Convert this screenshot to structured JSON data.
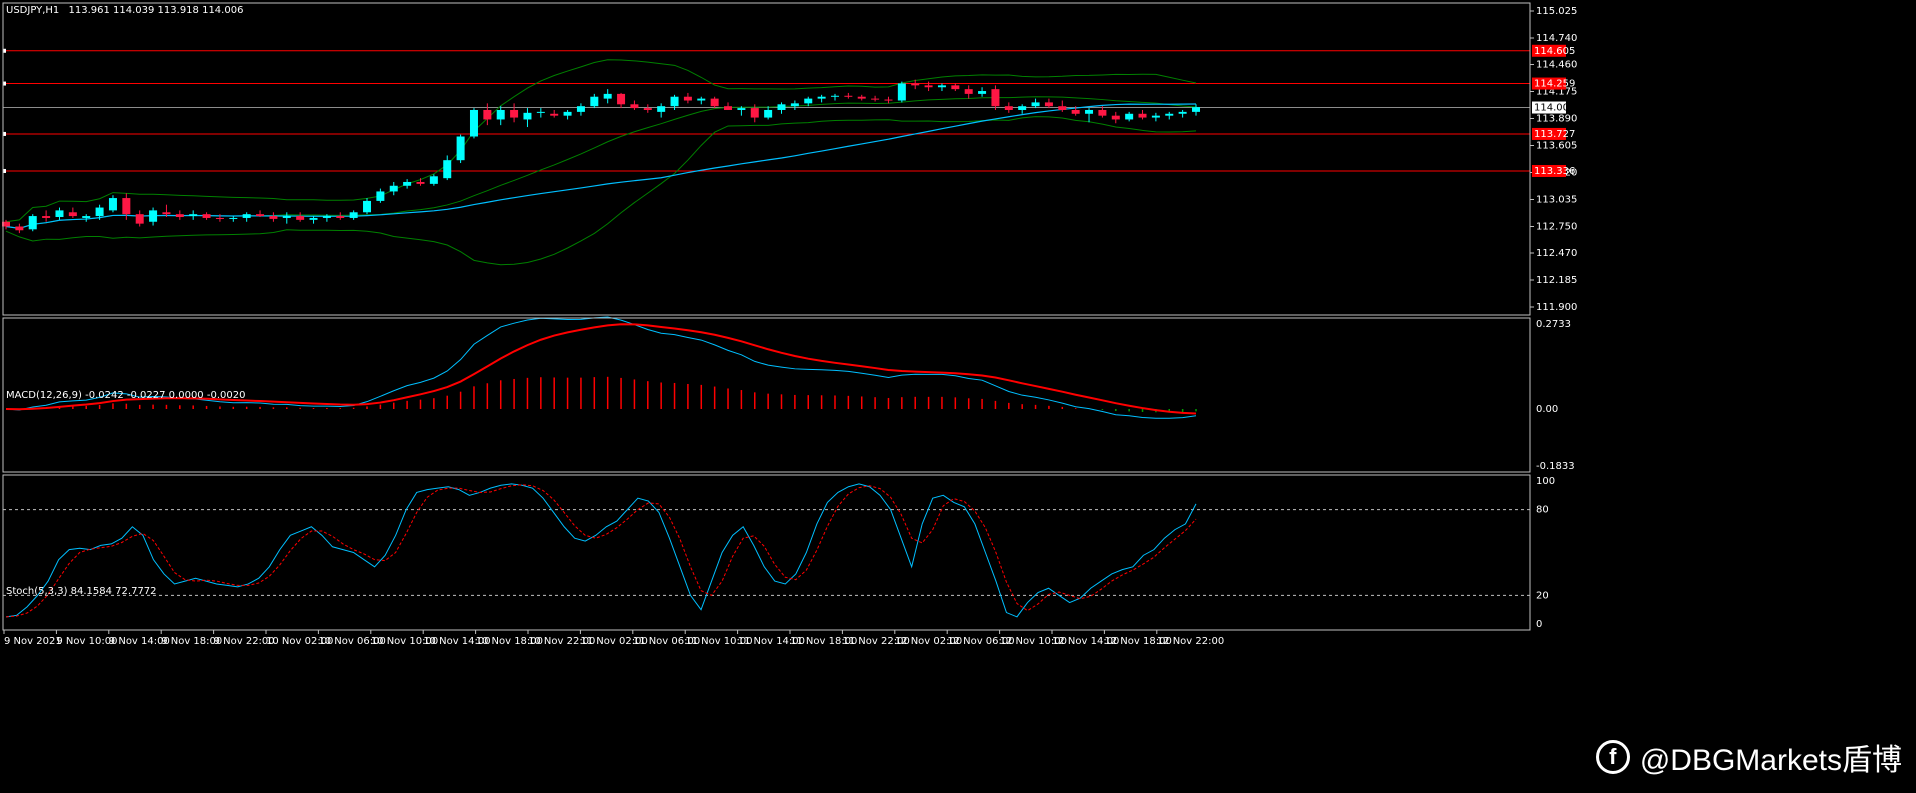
{
  "watermark": {
    "text": "@DBGMarkets盾博",
    "logo_icon": "f-logo-icon"
  },
  "colors": {
    "bg": "#000000",
    "frame": "#c0c0c0",
    "bull": "#00ffff",
    "bear": "#ff1744",
    "ma": "#00bfff",
    "bands": "#008000",
    "hline": "#ff0000",
    "macd_main": "#ffffff",
    "macd_signal": "#ff0000",
    "hist_pos": "#ff0000",
    "hist_neg": "#00a000",
    "stoch_main": "#00bfff",
    "stoch_signal": "#ff0000",
    "price_box": "#ffffff"
  },
  "chart_data": [
    {
      "type": "candlestick",
      "title": "USDJPY,H1",
      "ohlc_text": "113.961 114.039 113.918 114.006",
      "ylim": [
        111.9,
        115.025
      ],
      "price_ticks": [
        "115.025",
        "114.740",
        "114.460",
        "114.175",
        "113.890",
        "113.605",
        "113.320",
        "113.035",
        "112.750",
        "112.470",
        "112.185",
        "111.900"
      ],
      "current_price": "114.006",
      "horizontal_levels": [
        {
          "value": 114.605,
          "label": "114.605"
        },
        {
          "value": 114.259,
          "label": "114.259"
        },
        {
          "value": 113.727,
          "label": "113.727"
        },
        {
          "value": 113.336,
          "label": "113.336"
        }
      ],
      "x_labels": [
        "9 Nov 2021",
        "9 Nov 10:00",
        "9 Nov 14:00",
        "9 Nov 18:00",
        "9 Nov 22:00",
        "10 Nov 02:00",
        "10 Nov 06:00",
        "10 Nov 10:00",
        "10 Nov 14:00",
        "10 Nov 18:00",
        "10 Nov 22:00",
        "11 Nov 02:00",
        "11 Nov 06:00",
        "11 Nov 10:00",
        "11 Nov 14:00",
        "11 Nov 18:00",
        "11 Nov 22:00",
        "12 Nov 02:00",
        "12 Nov 06:00",
        "12 Nov 10:00",
        "12 Nov 14:00",
        "12 Nov 18:00",
        "12 Nov 22:00"
      ],
      "candles": [
        [
          112.8,
          112.82,
          112.72,
          112.75
        ],
        [
          112.75,
          112.78,
          112.68,
          112.71
        ],
        [
          112.72,
          112.88,
          112.7,
          112.86
        ],
        [
          112.86,
          112.92,
          112.8,
          112.84
        ],
        [
          112.85,
          112.95,
          112.82,
          112.92
        ],
        [
          112.9,
          112.95,
          112.84,
          112.86
        ],
        [
          112.84,
          112.88,
          112.8,
          112.86
        ],
        [
          112.86,
          112.98,
          112.82,
          112.95
        ],
        [
          112.92,
          113.08,
          112.9,
          113.05
        ],
        [
          113.05,
          113.1,
          112.82,
          112.88
        ],
        [
          112.88,
          112.92,
          112.75,
          112.78
        ],
        [
          112.8,
          112.95,
          112.76,
          112.92
        ],
        [
          112.9,
          112.98,
          112.85,
          112.88
        ],
        [
          112.88,
          112.92,
          112.82,
          112.85
        ],
        [
          112.86,
          112.92,
          112.82,
          112.88
        ],
        [
          112.88,
          112.9,
          112.82,
          112.84
        ],
        [
          112.84,
          112.88,
          112.8,
          112.83
        ],
        [
          112.83,
          112.86,
          112.8,
          112.84
        ],
        [
          112.84,
          112.9,
          112.8,
          112.88
        ],
        [
          112.88,
          112.92,
          112.85,
          112.86
        ],
        [
          112.86,
          112.9,
          112.8,
          112.83
        ],
        [
          112.84,
          112.9,
          112.78,
          112.86
        ],
        [
          112.86,
          112.9,
          112.8,
          112.82
        ],
        [
          112.82,
          112.86,
          112.78,
          112.84
        ],
        [
          112.84,
          112.88,
          112.8,
          112.86
        ],
        [
          112.86,
          112.9,
          112.82,
          112.84
        ],
        [
          112.84,
          112.92,
          112.82,
          112.9
        ],
        [
          112.9,
          113.05,
          112.88,
          113.02
        ],
        [
          113.02,
          113.15,
          113.0,
          113.12
        ],
        [
          113.12,
          113.22,
          113.08,
          113.18
        ],
        [
          113.18,
          113.25,
          113.15,
          113.22
        ],
        [
          113.22,
          113.26,
          113.18,
          113.2
        ],
        [
          113.2,
          113.3,
          113.18,
          113.28
        ],
        [
          113.26,
          113.5,
          113.24,
          113.45
        ],
        [
          113.45,
          113.72,
          113.42,
          113.7
        ],
        [
          113.7,
          114.0,
          113.68,
          113.98
        ],
        [
          113.98,
          114.05,
          113.82,
          113.88
        ],
        [
          113.88,
          114.02,
          113.82,
          113.98
        ],
        [
          113.98,
          114.05,
          113.85,
          113.9
        ],
        [
          113.88,
          114.0,
          113.8,
          113.95
        ],
        [
          113.95,
          114.0,
          113.9,
          113.96
        ],
        [
          113.94,
          113.98,
          113.9,
          113.92
        ],
        [
          113.92,
          113.98,
          113.88,
          113.96
        ],
        [
          113.96,
          114.05,
          113.92,
          114.02
        ],
        [
          114.02,
          114.15,
          114.0,
          114.12
        ],
        [
          114.1,
          114.2,
          114.05,
          114.15
        ],
        [
          114.15,
          114.16,
          114.0,
          114.04
        ],
        [
          114.04,
          114.08,
          113.98,
          114.0
        ],
        [
          114.0,
          114.04,
          113.95,
          113.98
        ],
        [
          113.96,
          114.05,
          113.9,
          114.02
        ],
        [
          114.02,
          114.14,
          113.98,
          114.12
        ],
        [
          114.12,
          114.16,
          114.05,
          114.08
        ],
        [
          114.08,
          114.12,
          114.04,
          114.1
        ],
        [
          114.1,
          114.12,
          114.0,
          114.02
        ],
        [
          114.02,
          114.06,
          113.98,
          113.98
        ],
        [
          113.98,
          114.02,
          113.92,
          114.0
        ],
        [
          114.0,
          114.04,
          113.85,
          113.9
        ],
        [
          113.9,
          114.02,
          113.88,
          113.98
        ],
        [
          113.98,
          114.06,
          113.94,
          114.04
        ],
        [
          114.02,
          114.08,
          113.98,
          114.05
        ],
        [
          114.05,
          114.12,
          114.02,
          114.1
        ],
        [
          114.1,
          114.14,
          114.06,
          114.12
        ],
        [
          114.12,
          114.15,
          114.08,
          114.13
        ],
        [
          114.13,
          114.16,
          114.1,
          114.12
        ],
        [
          114.12,
          114.14,
          114.08,
          114.1
        ],
        [
          114.1,
          114.13,
          114.07,
          114.09
        ],
        [
          114.09,
          114.12,
          114.05,
          114.08
        ],
        [
          114.08,
          114.28,
          114.06,
          114.26
        ],
        [
          114.26,
          114.3,
          114.2,
          114.24
        ],
        [
          114.24,
          114.28,
          114.18,
          114.22
        ],
        [
          114.22,
          114.26,
          114.18,
          114.24
        ],
        [
          114.24,
          114.26,
          114.18,
          114.2
        ],
        [
          114.2,
          114.24,
          114.1,
          114.15
        ],
        [
          114.15,
          114.22,
          114.12,
          114.18
        ],
        [
          114.2,
          114.24,
          113.98,
          114.02
        ],
        [
          114.02,
          114.06,
          113.95,
          113.98
        ],
        [
          113.98,
          114.04,
          113.94,
          114.02
        ],
        [
          114.02,
          114.1,
          114.0,
          114.06
        ],
        [
          114.06,
          114.1,
          114.0,
          114.02
        ],
        [
          114.02,
          114.08,
          113.96,
          113.98
        ],
        [
          113.98,
          114.02,
          113.92,
          113.94
        ],
        [
          113.94,
          114.0,
          113.85,
          113.98
        ],
        [
          113.98,
          114.02,
          113.9,
          113.92
        ],
        [
          113.92,
          113.96,
          113.84,
          113.88
        ],
        [
          113.88,
          113.96,
          113.86,
          113.94
        ],
        [
          113.94,
          113.98,
          113.88,
          113.9
        ],
        [
          113.9,
          113.95,
          113.86,
          113.92
        ],
        [
          113.92,
          113.96,
          113.88,
          113.94
        ],
        [
          113.94,
          113.98,
          113.9,
          113.96
        ],
        [
          113.96,
          114.04,
          113.92,
          114.01
        ]
      ],
      "bollinger_and_ma_note": ""
    },
    {
      "type": "macd",
      "title": "MACD(12,26,9) -0.0242 -0.0227 0.0000 -0.0020",
      "ylim": [
        -0.1833,
        0.2733
      ],
      "y_ticks": [
        "0.2733",
        "0.00",
        "-0.1833"
      ]
    },
    {
      "type": "stochastic",
      "title": "Stoch(5,3,3) 84.1584 72.7772",
      "ylim": [
        0,
        100
      ],
      "y_ticks": [
        "100",
        "80",
        "20",
        "0"
      ],
      "levels": [
        80,
        20
      ],
      "main": [
        5,
        6,
        12,
        20,
        30,
        45,
        52,
        53,
        52,
        55,
        56,
        60,
        68,
        62,
        45,
        35,
        28,
        30,
        32,
        30,
        28,
        27,
        26,
        28,
        32,
        40,
        52,
        62,
        65,
        68,
        62,
        54,
        52,
        50,
        45,
        40,
        48,
        62,
        80,
        92,
        94,
        95,
        96,
        94,
        90,
        92,
        95,
        97,
        98,
        97,
        95,
        88,
        78,
        68,
        60,
        58,
        62,
        68,
        72,
        80,
        88,
        86,
        78,
        60,
        40,
        20,
        10,
        30,
        50,
        62,
        68,
        55,
        40,
        30,
        28,
        35,
        50,
        70,
        85,
        92,
        96,
        98,
        96,
        90,
        80,
        60,
        40,
        70,
        88,
        90,
        85,
        82,
        70,
        50,
        30,
        8,
        5,
        15,
        22,
        25,
        20,
        15,
        18,
        25,
        30,
        35,
        38,
        40,
        48,
        52,
        60,
        66,
        70,
        84
      ]
    }
  ]
}
